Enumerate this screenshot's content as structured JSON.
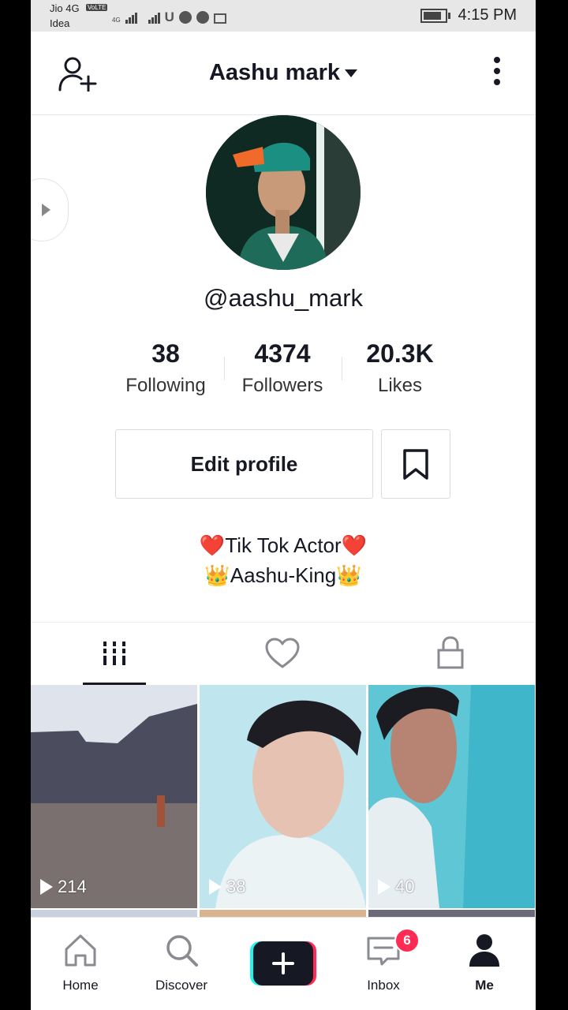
{
  "status_bar": {
    "carrier1": "Jio 4G",
    "volte": "VoLTE",
    "net_small": "4G",
    "carrier2": "Idea",
    "time": "4:15 PM"
  },
  "header": {
    "username": "Aashu mark"
  },
  "profile": {
    "handle": "@aashu_mark",
    "stats": [
      {
        "value": "38",
        "label": "Following"
      },
      {
        "value": "4374",
        "label": "Followers"
      },
      {
        "value": "20.3K",
        "label": "Likes"
      }
    ],
    "edit_button": "Edit profile",
    "bio_line1": "❤️Tik Tok Actor❤️",
    "bio_line2": "👑Aashu-King👑"
  },
  "tabs": [
    {
      "icon": "grid-icon",
      "active": true
    },
    {
      "icon": "heart-icon",
      "active": false
    },
    {
      "icon": "lock-icon",
      "active": false
    }
  ],
  "videos": [
    {
      "views": "214"
    },
    {
      "views": "38"
    },
    {
      "views": "40"
    }
  ],
  "nav": {
    "home": "Home",
    "discover": "Discover",
    "inbox": "Inbox",
    "inbox_badge": "6",
    "me": "Me"
  },
  "colors": {
    "accent": "#fe2c55",
    "cyan": "#25f4ee",
    "text": "#161823"
  }
}
